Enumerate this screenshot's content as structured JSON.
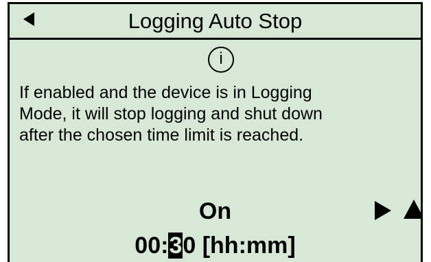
{
  "header": {
    "title": "Logging Auto Stop",
    "back_icon": "left-triangle-icon"
  },
  "info": {
    "icon": "info-circle-icon",
    "glyph": "i",
    "message_lines": [
      "If enabled and the device is in Logging",
      "Mode, it will stop logging and shut down",
      "after the chosen time limit is reached."
    ]
  },
  "setting": {
    "state": "On",
    "time_prefix": "00:",
    "time_cursor_digit": "3",
    "time_suffix": "0 [hh:mm]"
  },
  "nav": {
    "right_icon": "right-triangle-icon",
    "up_icon": "up-triangle-icon"
  },
  "colors": {
    "screen_background": "#d7e8d7",
    "foreground": "#000000"
  }
}
